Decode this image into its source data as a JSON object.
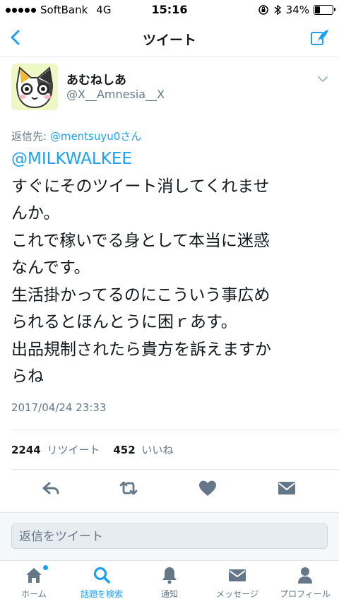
{
  "status_bar": {
    "carrier": "SoftBank",
    "network": "4G",
    "time": "15:16",
    "battery": "34%",
    "battery_level": 0.34
  },
  "nav": {
    "title": "ツイート"
  },
  "tweet": {
    "display_name": "あむねしあ",
    "username": "@X__Amnesia__X",
    "reply_prefix": "返信先: ",
    "reply_mention": "@mentsuyu0さん",
    "mention": "@MILKWALKEE",
    "lines": [
      "すぐにそのツイート消してくれませ",
      "んか。",
      "これで稼いでる身として本当に迷惑",
      "なんです。",
      "生活掛かってるのにこういう事広め",
      "られるとほんとうに困ｒあす。",
      "出品規制されたら貴方を訴えますか",
      "らね"
    ],
    "timestamp": "2017/04/24 23:33",
    "retweet_count": "2244",
    "retweet_label": "リツイート",
    "like_count": "452",
    "like_label": "いいね"
  },
  "reply_box": {
    "placeholder": "返信をツイート"
  },
  "tabs": [
    {
      "label": "ホーム",
      "icon": "home-icon"
    },
    {
      "label": "話題を検索",
      "icon": "search-icon"
    },
    {
      "label": "通知",
      "icon": "bell-icon"
    },
    {
      "label": "メッセージ",
      "icon": "envelope-icon"
    },
    {
      "label": "プロフィール",
      "icon": "person-icon"
    }
  ],
  "colors": {
    "accent": "#1da1f2",
    "gray": "#657786",
    "action_gray": "#657786"
  }
}
